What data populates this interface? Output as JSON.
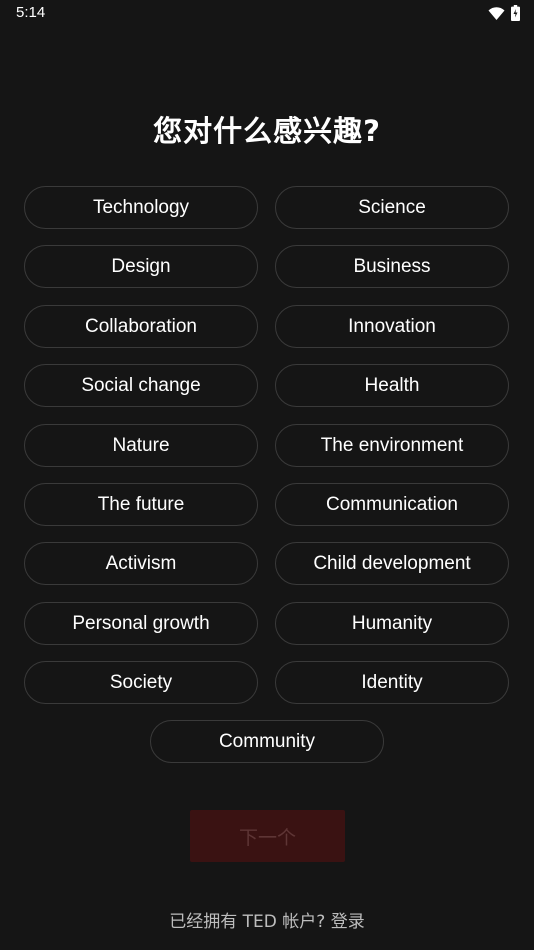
{
  "status_bar": {
    "time": "5:14",
    "wifi_icon": "wifi-icon",
    "battery_icon": "battery-charging-icon"
  },
  "title": "您对什么感兴趣?",
  "topics": [
    "Technology",
    "Science",
    "Design",
    "Business",
    "Collaboration",
    "Innovation",
    "Social change",
    "Health",
    "Nature",
    "The environment",
    "The future",
    "Communication",
    "Activism",
    "Child development",
    "Personal growth",
    "Humanity",
    "Society",
    "Identity",
    "Community"
  ],
  "next_button": {
    "label": "下一个"
  },
  "login_prompt": {
    "text": "已经拥有 TED 帐户?",
    "link": "登录"
  },
  "colors": {
    "background": "#151515",
    "chip_border": "#3a3a3a",
    "next_button_bg": "#3a1212",
    "next_button_text": "#5e3535"
  }
}
